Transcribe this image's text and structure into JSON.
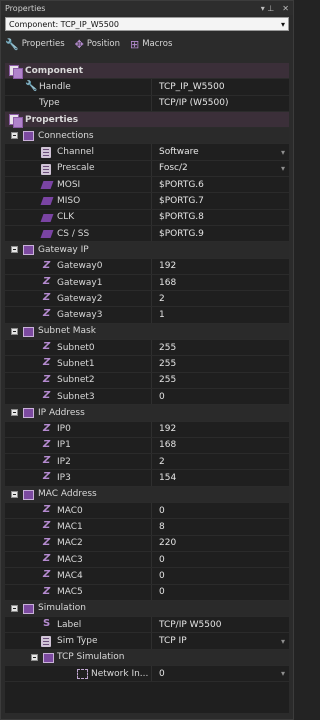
{
  "panel": {
    "title": "Properties",
    "title_icons": [
      "pin-icon",
      "close-icon"
    ]
  },
  "component_select": {
    "value": "Component: TCP_IP_W5500"
  },
  "tabs": [
    {
      "label": "Properties",
      "icon": "wrench-icon"
    },
    {
      "label": "Position",
      "icon": "move-icon"
    },
    {
      "label": "Macros",
      "icon": "macro-icon"
    }
  ],
  "component": {
    "title": "Component",
    "handle_label": "Handle",
    "handle_value": "TCP_IP_W5500",
    "type_label": "Type",
    "type_value": "TCP/IP (W5500)"
  },
  "properties": {
    "title": "Properties",
    "connections": {
      "title": "Connections",
      "channel_label": "Channel",
      "channel_value": "Software",
      "prescale_label": "Prescale",
      "prescale_value": "Fosc/2",
      "mosi_label": "MOSI",
      "mosi_value": "$PORTG.6",
      "miso_label": "MISO",
      "miso_value": "$PORTG.7",
      "clk_label": "CLK",
      "clk_value": "$PORTG.8",
      "cs_label": "CS / SS",
      "cs_value": "$PORTG.9"
    },
    "gateway": {
      "title": "Gateway IP",
      "items": [
        {
          "label": "Gateway0",
          "value": "192"
        },
        {
          "label": "Gateway1",
          "value": "168"
        },
        {
          "label": "Gateway2",
          "value": "2"
        },
        {
          "label": "Gateway3",
          "value": "1"
        }
      ]
    },
    "subnet": {
      "title": "Subnet Mask",
      "items": [
        {
          "label": "Subnet0",
          "value": "255"
        },
        {
          "label": "Subnet1",
          "value": "255"
        },
        {
          "label": "Subnet2",
          "value": "255"
        },
        {
          "label": "Subnet3",
          "value": "0"
        }
      ]
    },
    "ip": {
      "title": "IP Address",
      "items": [
        {
          "label": "IP0",
          "value": "192"
        },
        {
          "label": "IP1",
          "value": "168"
        },
        {
          "label": "IP2",
          "value": "2"
        },
        {
          "label": "IP3",
          "value": "154"
        }
      ]
    },
    "mac": {
      "title": "MAC Address",
      "items": [
        {
          "label": "MAC0",
          "value": "0"
        },
        {
          "label": "MAC1",
          "value": "8"
        },
        {
          "label": "MAC2",
          "value": "220"
        },
        {
          "label": "MAC3",
          "value": "0"
        },
        {
          "label": "MAC4",
          "value": "0"
        },
        {
          "label": "MAC5",
          "value": "0"
        }
      ]
    },
    "simulation": {
      "title": "Simulation",
      "label_label": "Label",
      "label_value": "TCP/IP W5500",
      "simtype_label": "Sim Type",
      "simtype_value": "TCP IP",
      "tcp_title": "TCP Simulation",
      "network_label": "Network In...",
      "network_value": "0"
    }
  }
}
